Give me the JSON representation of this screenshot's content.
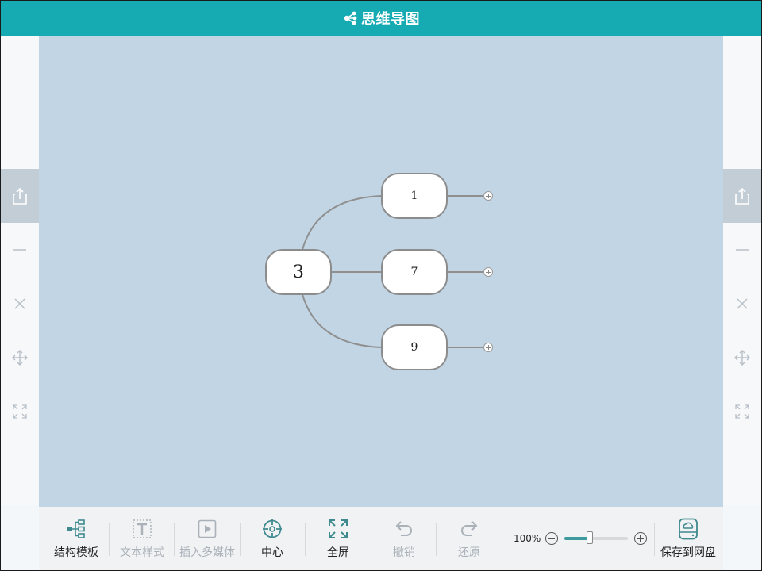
{
  "app": {
    "title": "思维导图",
    "accent_color": "#16aab3",
    "canvas_color": "#c2d5e4"
  },
  "side_tools": {
    "left": [
      "share-icon",
      "minimize-icon",
      "close-icon",
      "move-icon",
      "fit-icon"
    ],
    "right": [
      "share-icon",
      "minimize-icon",
      "close-icon",
      "move-icon",
      "fit-icon"
    ]
  },
  "mindmap": {
    "root": {
      "label": "3"
    },
    "children": [
      {
        "label": "1"
      },
      {
        "label": "7"
      },
      {
        "label": "9"
      }
    ]
  },
  "toolbar": {
    "structure_template": "结构模板",
    "text_style": "文本样式",
    "insert_media": "插入多媒体",
    "center": "中心",
    "fullscreen": "全屏",
    "undo": "撤销",
    "redo": "还原",
    "zoom_label": "100%",
    "zoom_level": 0.4,
    "save_to_disk": "保存到网盘"
  }
}
